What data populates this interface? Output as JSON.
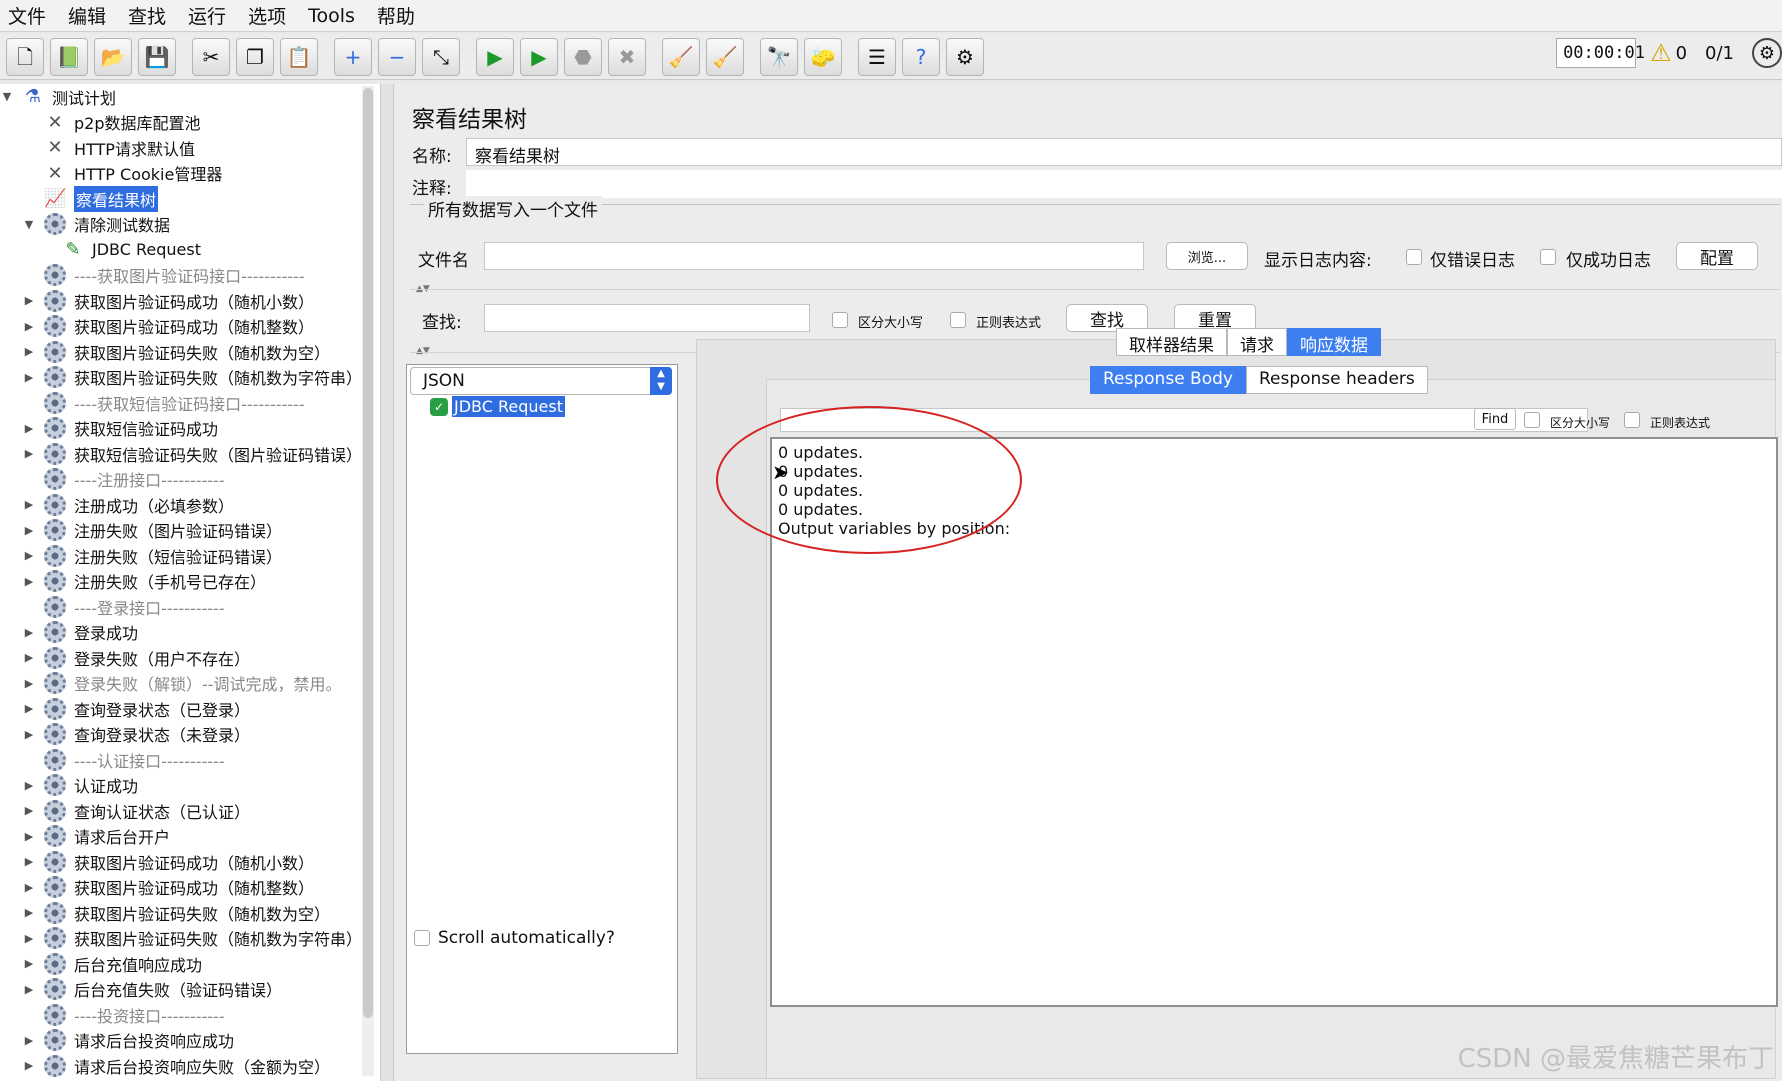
{
  "menu": [
    "文件",
    "编辑",
    "查找",
    "运行",
    "选项",
    "Tools",
    "帮助"
  ],
  "toolbar": {
    "icons": [
      "new-file-icon",
      "templates-icon",
      "open-icon",
      "save-icon",
      "cut-icon",
      "copy-icon",
      "paste-icon",
      "expand-icon",
      "collapse-icon",
      "toggle-icon",
      "start-icon",
      "start-no-pause-icon",
      "stop-icon",
      "shutdown-icon",
      "clear-icon",
      "clear-all-icon",
      "search-binoculars-icon",
      "reset-search-icon",
      "function-helper-icon",
      "help-icon",
      "remote-icon"
    ],
    "timer": "00:00:01",
    "warn_count": "0",
    "threads": "0/1"
  },
  "tree": {
    "root": "测试计划",
    "items": [
      {
        "label": "p2p数据库配置池",
        "type": "tool",
        "level": 1
      },
      {
        "label": "HTTP请求默认值",
        "type": "tool",
        "level": 1
      },
      {
        "label": "HTTP Cookie管理器",
        "type": "tool",
        "level": 1
      },
      {
        "label": "察看结果树",
        "type": "listener",
        "level": 1,
        "selected": true
      },
      {
        "label": "清除测试数据",
        "type": "cog",
        "level": 1,
        "expanded": true
      },
      {
        "label": "JDBC Request",
        "type": "sampler",
        "level": 2
      },
      {
        "label": "----获取图片验证码接口-----------",
        "type": "cog",
        "level": 1,
        "dim": true
      },
      {
        "label": "获取图片验证码成功（随机小数）",
        "type": "cog",
        "level": 1,
        "arrow": true
      },
      {
        "label": "获取图片验证码成功（随机整数）",
        "type": "cog",
        "level": 1,
        "arrow": true
      },
      {
        "label": "获取图片验证码失败（随机数为空）",
        "type": "cog",
        "level": 1,
        "arrow": true
      },
      {
        "label": "获取图片验证码失败（随机数为字符串）",
        "type": "cog",
        "level": 1,
        "arrow": true
      },
      {
        "label": "----获取短信验证码接口-----------",
        "type": "cog",
        "level": 1,
        "dim": true
      },
      {
        "label": "获取短信验证码成功",
        "type": "cog",
        "level": 1,
        "arrow": true
      },
      {
        "label": "获取短信验证码失败（图片验证码错误）",
        "type": "cog",
        "level": 1,
        "arrow": true
      },
      {
        "label": "----注册接口-----------",
        "type": "cog",
        "level": 1,
        "dim": true
      },
      {
        "label": "注册成功（必填参数）",
        "type": "cog",
        "level": 1,
        "arrow": true
      },
      {
        "label": "注册失败（图片验证码错误）",
        "type": "cog",
        "level": 1,
        "arrow": true
      },
      {
        "label": "注册失败（短信验证码错误）",
        "type": "cog",
        "level": 1,
        "arrow": true
      },
      {
        "label": "注册失败（手机号已存在）",
        "type": "cog",
        "level": 1,
        "arrow": true
      },
      {
        "label": "----登录接口-----------",
        "type": "cog",
        "level": 1,
        "dim": true
      },
      {
        "label": "登录成功",
        "type": "cog",
        "level": 1,
        "arrow": true
      },
      {
        "label": "登录失败（用户不存在）",
        "type": "cog",
        "level": 1,
        "arrow": true
      },
      {
        "label": "登录失败（解锁）--调试完成，禁用。",
        "type": "cog",
        "level": 1,
        "arrow": true,
        "dim": true
      },
      {
        "label": "查询登录状态（已登录）",
        "type": "cog",
        "level": 1,
        "arrow": true
      },
      {
        "label": "查询登录状态（未登录）",
        "type": "cog",
        "level": 1,
        "arrow": true
      },
      {
        "label": "----认证接口-----------",
        "type": "cog",
        "level": 1,
        "dim": true
      },
      {
        "label": "认证成功",
        "type": "cog",
        "level": 1,
        "arrow": true
      },
      {
        "label": "查询认证状态（已认证）",
        "type": "cog",
        "level": 1,
        "arrow": true
      },
      {
        "label": "请求后台开户",
        "type": "cog",
        "level": 1,
        "arrow": true
      },
      {
        "label": "获取图片验证码成功（随机小数）",
        "type": "cog",
        "level": 1,
        "arrow": true
      },
      {
        "label": "获取图片验证码成功（随机整数）",
        "type": "cog",
        "level": 1,
        "arrow": true
      },
      {
        "label": "获取图片验证码失败（随机数为空）",
        "type": "cog",
        "level": 1,
        "arrow": true
      },
      {
        "label": "获取图片验证码失败（随机数为字符串）",
        "type": "cog",
        "level": 1,
        "arrow": true
      },
      {
        "label": "后台充值响应成功",
        "type": "cog",
        "level": 1,
        "arrow": true
      },
      {
        "label": "后台充值失败（验证码错误）",
        "type": "cog",
        "level": 1,
        "arrow": true
      },
      {
        "label": "----投资接口-----------",
        "type": "cog",
        "level": 1,
        "dim": true
      },
      {
        "label": "请求后台投资响应成功",
        "type": "cog",
        "level": 1,
        "arrow": true
      },
      {
        "label": "请求后台投资响应失败（金额为空）",
        "type": "cog",
        "level": 1,
        "arrow": true
      }
    ]
  },
  "panel": {
    "title": "察看结果树",
    "name_label": "名称:",
    "name_value": "察看结果树",
    "comment_label": "注释:",
    "comment_value": "",
    "group_title": "所有数据写入一个文件",
    "filename_label": "文件名",
    "filename_value": "",
    "browse_button": "浏览...",
    "log_label": "显示日志内容:",
    "errors_only": "仅错误日志",
    "success_only": "仅成功日志",
    "configure_button": "配置",
    "search_label": "查找:",
    "search_value": "",
    "case_sensitive": "区分大小写",
    "regex": "正则表达式",
    "search_button": "查找",
    "reset_button": "重置"
  },
  "results": {
    "renderer": "JSON",
    "node": "JDBC Request",
    "tabs": [
      "取样器结果",
      "请求",
      "响应数据"
    ],
    "active_tab": "响应数据",
    "subtabs": [
      "Response Body",
      "Response headers"
    ],
    "active_subtab": "Response Body",
    "find_button": "Find",
    "find_case": "区分大小写",
    "find_regex": "正则表达式",
    "response_lines": [
      "0 updates.",
      "0 updates.",
      "0 updates.",
      "0 updates.",
      "Output variables by position:"
    ],
    "scroll_auto": "Scroll automatically?"
  },
  "watermark": "CSDN @最爱焦糖芒果布丁",
  "colors": {
    "selection": "#2f6ce0",
    "annotation_circle": "#d62222",
    "active_tab": "#3d7ef0"
  }
}
